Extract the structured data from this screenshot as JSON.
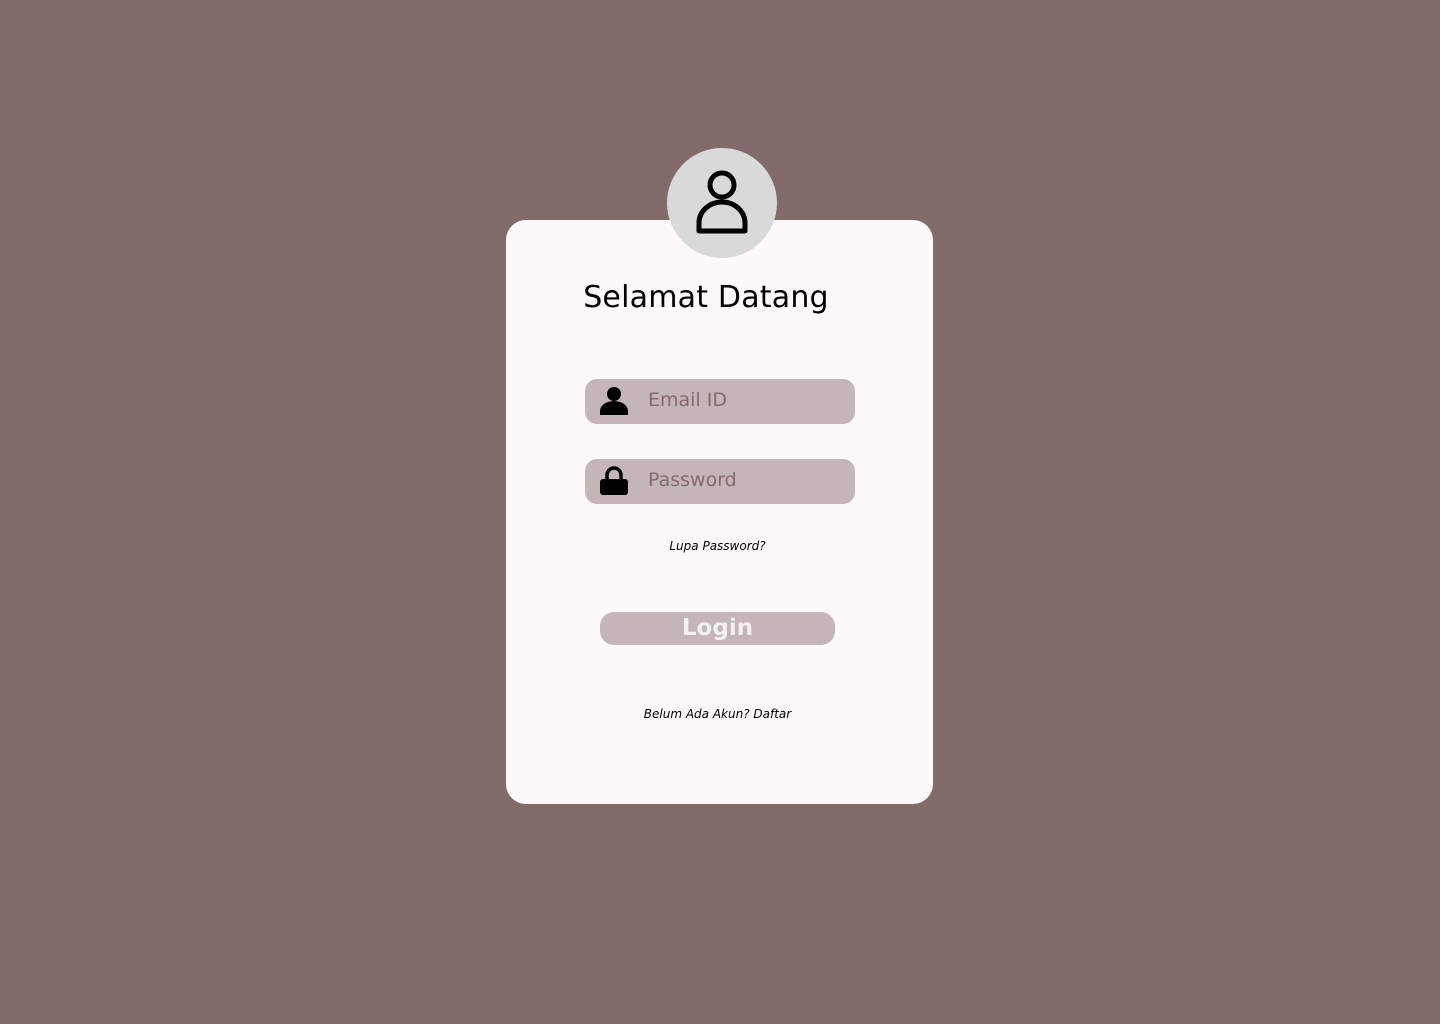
{
  "page": {
    "background_color": "#836B6B",
    "card_color": "#FFFAF9",
    "accent_color": "#C4B6B6"
  },
  "avatar": {
    "icon": "user-outline-icon"
  },
  "title": "Selamat Datang",
  "email_field": {
    "icon": "user-icon",
    "placeholder": "Email ID"
  },
  "password_field": {
    "icon": "lock-icon",
    "placeholder": "Password"
  },
  "forgot_password_link": "Lupa Password?",
  "login_button": "Login",
  "register_link": "Belum Ada Akun? Daftar"
}
